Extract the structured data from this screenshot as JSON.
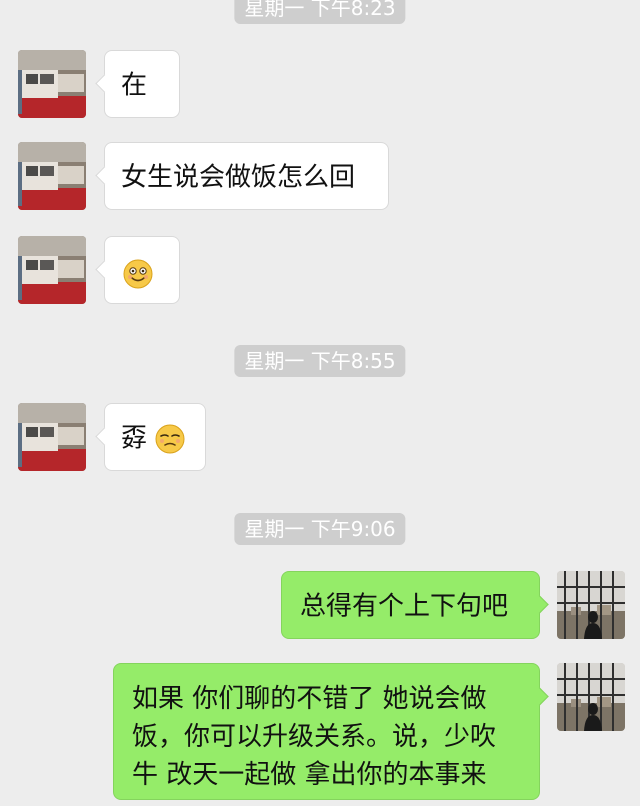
{
  "timestamps": [
    "星期一 下午8:23",
    "星期一 下午8:55",
    "星期一 下午9:06"
  ],
  "messages": [
    {
      "sender": "contact",
      "text": "在"
    },
    {
      "sender": "contact",
      "text": "女生说会做饭怎么回"
    },
    {
      "sender": "contact",
      "text": "",
      "emoji": "smiling-face-emoji"
    },
    {
      "sender": "contact",
      "text": "孬",
      "emoji": "unamused-face-emoji"
    },
    {
      "sender": "me",
      "text": "总得有个上下句吧"
    },
    {
      "sender": "me",
      "text_lines": [
        "如果 你们聊的不错了 她说会做",
        "饭，你可以升级关系。说，少吹",
        "牛 改天一起做 拿出你的本事来"
      ]
    }
  ],
  "colors": {
    "background": "#ededed",
    "incoming_bubble": "#ffffff",
    "outgoing_bubble": "#95ec69",
    "timestamp_chip": "#cecece"
  },
  "icons": {
    "contact_avatar": "fire-truck-photo-avatar",
    "my_avatar": "window-silhouette-photo-avatar"
  }
}
